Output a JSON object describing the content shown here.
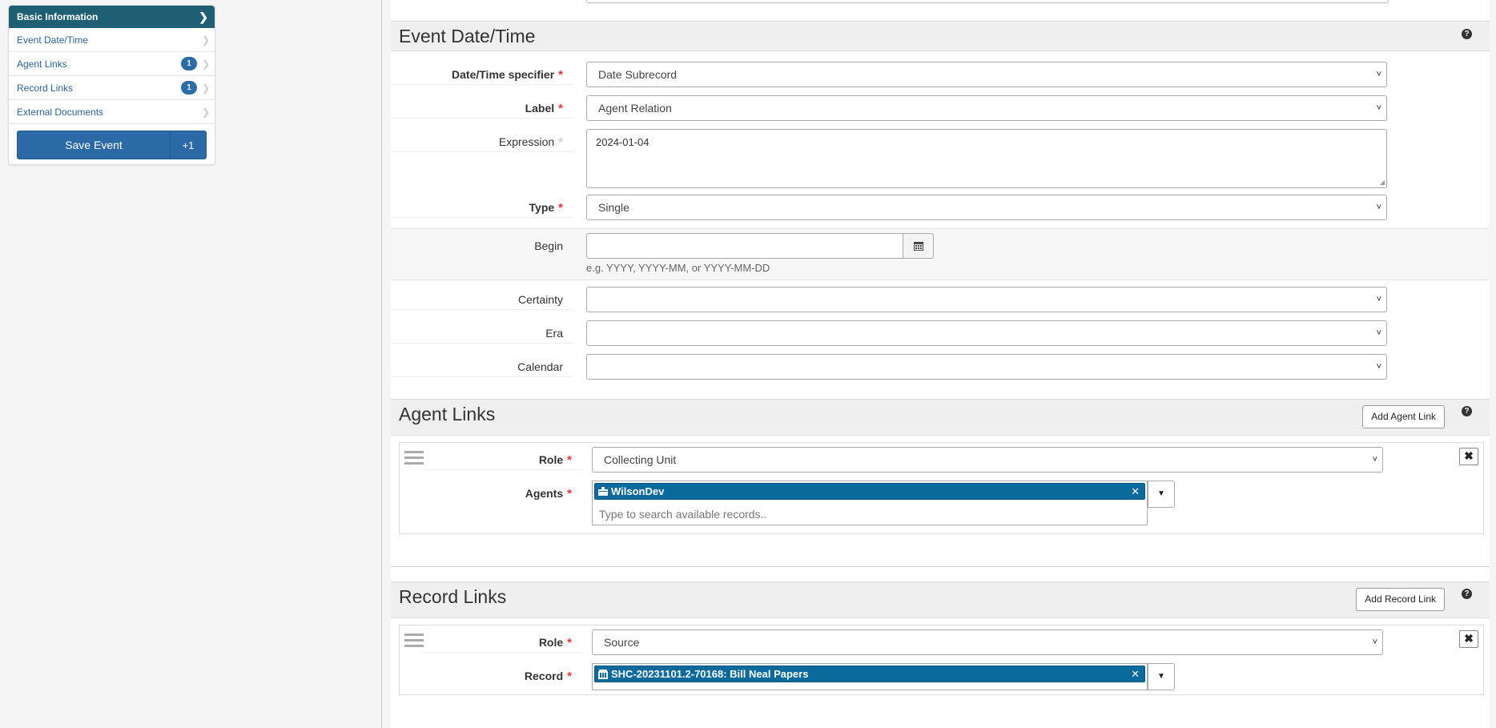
{
  "sidebar": {
    "header": "Basic Information",
    "items": [
      {
        "label": "Event Date/Time"
      },
      {
        "label": "Agent Links",
        "badge": "1"
      },
      {
        "label": "Record Links",
        "badge": "1"
      },
      {
        "label": "External Documents"
      }
    ],
    "save_label": "Save Event",
    "save_extra": "+1"
  },
  "date_section": {
    "title": "Event Date/Time",
    "specifier_label": "Date/Time specifier",
    "specifier_value": "Date Subrecord",
    "label_label": "Label",
    "label_value": "Agent Relation",
    "expression_label": "Expression",
    "expression_value": "2024-01-04",
    "type_label": "Type",
    "type_value": "Single",
    "begin_label": "Begin",
    "begin_hint": "e.g. YYYY, YYYY-MM, or YYYY-MM-DD",
    "certainty_label": "Certainty",
    "era_label": "Era",
    "calendar_label": "Calendar"
  },
  "agent_section": {
    "title": "Agent Links",
    "add_button": "Add Agent Link",
    "role_label": "Role",
    "role_value": "Collecting Unit",
    "agents_label": "Agents",
    "agent_token": "WilsonDev",
    "search_placeholder": "Type to search available records.."
  },
  "record_section": {
    "title": "Record Links",
    "add_button": "Add Record Link",
    "role_label": "Role",
    "role_value": "Source",
    "record_label": "Record",
    "record_token": "SHC-20231101.2-70168: Bill Neal Papers"
  },
  "colors": {
    "sidebar_header": "#1f5f74",
    "primary_button": "#2b6aa6",
    "token": "#0a6a9b",
    "required": "#e33333"
  }
}
